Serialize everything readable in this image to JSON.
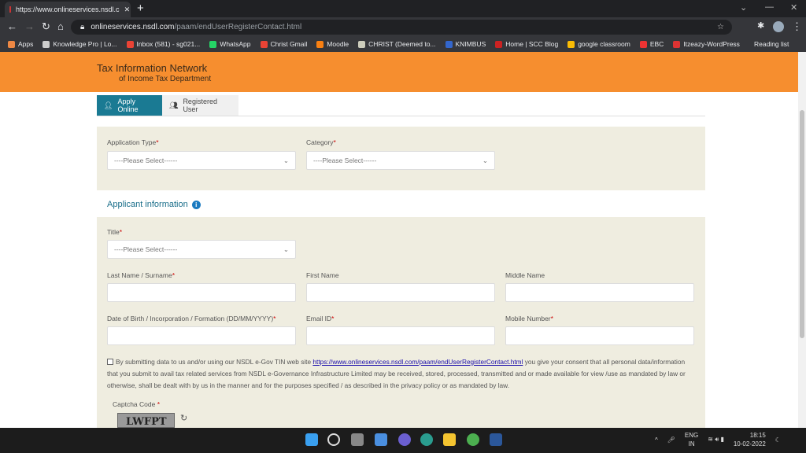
{
  "browser": {
    "tab_title": "https://www.onlineservices.nsdl.c",
    "url_host": "onlineservices.nsdl.com",
    "url_path": "/paam/endUserRegisterContact.html",
    "bookmarks": [
      {
        "label": "Apps",
        "color": "#e84"
      },
      {
        "label": "Knowledge Pro | Lo...",
        "color": "#ccc"
      },
      {
        "label": "Inbox (581) - sg021...",
        "color": "#ea4335"
      },
      {
        "label": "WhatsApp",
        "color": "#25d366"
      },
      {
        "label": "Christ Gmail",
        "color": "#ea4335"
      },
      {
        "label": "Moodle",
        "color": "#f98012"
      },
      {
        "label": "CHRIST (Deemed to...",
        "color": "#ccb"
      },
      {
        "label": "KNIMBUS",
        "color": "#36c"
      },
      {
        "label": "Home | SCC Blog",
        "color": "#c22"
      },
      {
        "label": "google classroom",
        "color": "#fbbc04"
      },
      {
        "label": "EBC",
        "color": "#e33"
      },
      {
        "label": "Itzeazy-WordPress",
        "color": "#d33"
      }
    ],
    "reading_list": "Reading list"
  },
  "header": {
    "title": "Tax Information Network",
    "subtitle": "of Income Tax Department",
    "brand_color": "#f68e2f"
  },
  "tabs": [
    {
      "label": "Apply Online",
      "active": true
    },
    {
      "label": "Registered User",
      "active": false
    }
  ],
  "form": {
    "application_type": {
      "label": "Application Type",
      "value": "----Please Select------"
    },
    "category": {
      "label": "Category",
      "value": "----Please Select------"
    },
    "section_title": "Applicant information",
    "title": {
      "label": "Title",
      "value": "----Please Select------"
    },
    "last_name": {
      "label": "Last Name / Surname"
    },
    "first_name": {
      "label": "First Name"
    },
    "middle_name": {
      "label": "Middle Name"
    },
    "dob": {
      "label": "Date of Birth / Incorporation / Formation (DD/MM/YYYY)"
    },
    "email": {
      "label": "Email ID"
    },
    "mobile": {
      "label": "Mobile Number"
    },
    "required_mark": "*",
    "consent_pre": "By submitting data to us and/or using our NSDL e-Gov TIN web site ",
    "consent_link": "https://www.onlineservices.nsdl.com/paam/endUserRegisterContact.html",
    "consent_post": " you give your consent that all personal data/information that you submit to avail tax related services from NSDL e-Governance Infrastructure Limited may be received, stored, processed, transmitted and or made available for view /use as mandated by law or otherwise, shall be dealt with by us in the manner and for the purposes specified / as described in the privacy policy or as mandated by law.",
    "captcha_label": "Captcha Code",
    "captcha_text": "LWFPT"
  },
  "taskbar": {
    "lang1": "ENG",
    "lang2": "IN",
    "time": "18:15",
    "date": "10-02-2022"
  }
}
